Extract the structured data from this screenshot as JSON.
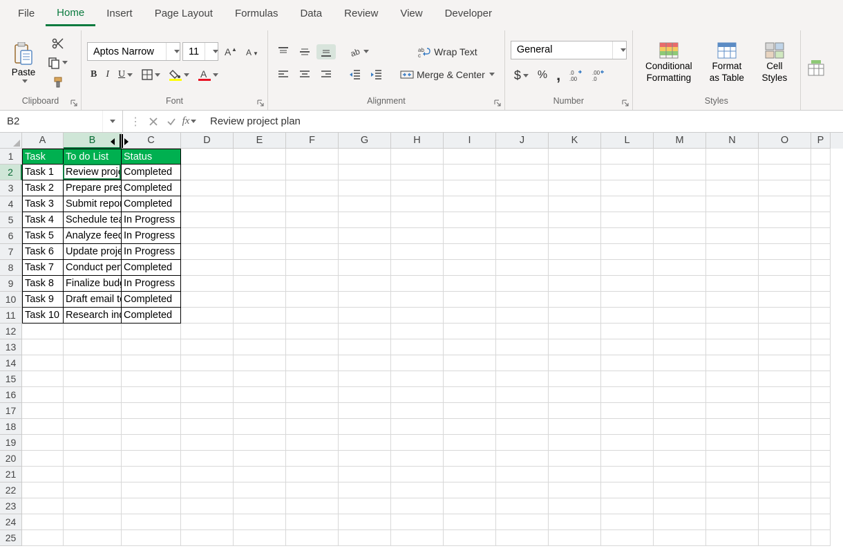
{
  "tabs": {
    "file": "File",
    "home": "Home",
    "insert": "Insert",
    "pagelayout": "Page Layout",
    "formulas": "Formulas",
    "data": "Data",
    "review": "Review",
    "view": "View",
    "developer": "Developer",
    "active": "home"
  },
  "clipboard": {
    "paste_label": "Paste",
    "group_label": "Clipboard"
  },
  "font": {
    "name": "Aptos Narrow",
    "size": "11",
    "group_label": "Font"
  },
  "alignment": {
    "wrap": "Wrap Text",
    "merge": "Merge & Center",
    "group_label": "Alignment"
  },
  "number": {
    "format": "General",
    "group_label": "Number"
  },
  "styles": {
    "cond": "Conditional Formatting",
    "fat": "Format as Table",
    "cell": "Cell Styles",
    "group_label": "Styles"
  },
  "namebox": "B2",
  "formula": "Review project plan",
  "col_widths": {
    "A": 60,
    "B": 84,
    "C": 86,
    "D": 76,
    "E": 76,
    "F": 76,
    "G": 76,
    "H": 76,
    "I": 76,
    "J": 76,
    "K": 76,
    "L": 76,
    "M": 76,
    "N": 76,
    "O": 76,
    "P": 28
  },
  "cols": [
    "A",
    "B",
    "C",
    "D",
    "E",
    "F",
    "G",
    "H",
    "I",
    "J",
    "K",
    "L",
    "M",
    "N",
    "O",
    "P"
  ],
  "rows": 25,
  "active_cell": {
    "col": "B",
    "row": 2
  },
  "header_row": {
    "A": "Task",
    "B": "To do List",
    "C": "Status"
  },
  "data": [
    {
      "A": "Task 1",
      "B": "Review project plan",
      "C": "Completed"
    },
    {
      "A": "Task 2",
      "B": "Prepare presentation",
      "C": "Completed"
    },
    {
      "A": "Task 3",
      "B": "Submit report",
      "C": "Completed"
    },
    {
      "A": "Task 4",
      "B": "Schedule team meeting",
      "C": "In Progress"
    },
    {
      "A": "Task 5",
      "B": "Analyze feedback",
      "C": "In Progress"
    },
    {
      "A": "Task 6",
      "B": "Update project timeline",
      "C": "In Progress"
    },
    {
      "A": "Task 7",
      "B": "Conduct performance review",
      "C": "Completed"
    },
    {
      "A": "Task 8",
      "B": "Finalize budget",
      "C": "In Progress"
    },
    {
      "A": "Task 9",
      "B": "Draft email to client",
      "C": "Completed"
    },
    {
      "A": "Task 10",
      "B": "Research industry trends",
      "C": "Completed"
    }
  ]
}
